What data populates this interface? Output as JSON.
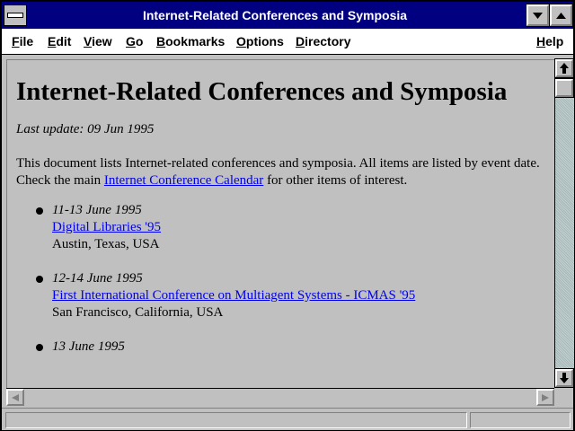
{
  "window": {
    "title": "Internet-Related Conferences and Symposia"
  },
  "menu": [
    {
      "first": "F",
      "rest": "ile"
    },
    {
      "first": "E",
      "rest": "dit"
    },
    {
      "first": "V",
      "rest": "iew"
    },
    {
      "first": "G",
      "rest": "o"
    },
    {
      "first": "B",
      "rest": "ookmarks"
    },
    {
      "first": "O",
      "rest": "ptions"
    },
    {
      "first": "D",
      "rest": "irectory"
    },
    {
      "first": "H",
      "rest": "elp"
    }
  ],
  "page": {
    "heading": "Internet-Related Conferences and Symposia",
    "last_update": "Last update: 09 Jun 1995",
    "intro_before": "This document lists Internet-related conferences and symposia. All items are listed by event date. Check the main ",
    "intro_link": "Internet Conference Calendar",
    "intro_after": " for other items of interest.",
    "events": [
      {
        "date": "11-13 June 1995",
        "title": "Digital Libraries '95",
        "location": "Austin, Texas, USA"
      },
      {
        "date": "12-14 June 1995",
        "title": "First International Conference on Multiagent Systems - ICMAS '95",
        "location": "San Francisco, California, USA"
      },
      {
        "date": "13 June 1995",
        "title": "",
        "location": ""
      }
    ]
  },
  "status": {
    "text": ""
  }
}
